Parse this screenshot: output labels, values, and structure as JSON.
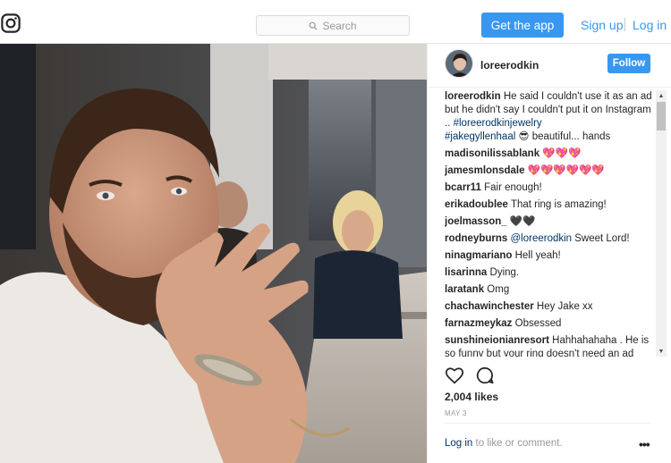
{
  "nav": {
    "search_placeholder": "Search",
    "get_app_label": "Get the app",
    "signup_label": "Sign up",
    "login_label": "Log in"
  },
  "post": {
    "owner": "loreerodkin",
    "follow_label": "Follow",
    "caption": {
      "user": "loreerodkin",
      "text_1": " He said I couldn't use it as an ad but he didn't say I couldn't put it on Instagram .. ",
      "tag_1": "#loreerodkinjewelry",
      "tag_2": "#jakegyllenhaal",
      "emoji": " 😎 ",
      "text_2": "beautiful... hands"
    },
    "comments": [
      {
        "user": "madisonilissablank",
        "text": " 💖💖💖"
      },
      {
        "user": "jamesmlonsdale",
        "text": " 💖💖💖💖💖💖"
      },
      {
        "user": "bcarr11",
        "text": " Fair enough!"
      },
      {
        "user": "erikadoublee",
        "text": " That ring is amazing!"
      },
      {
        "user": "joelmasson_",
        "text": " 🖤🖤"
      },
      {
        "user": "rodneyburns",
        "mention": " @loreerodkin",
        "text": " Sweet Lord!"
      },
      {
        "user": "ninagmariano",
        "text": " Hell yeah!"
      },
      {
        "user": "lisarinna",
        "text": " Dying."
      },
      {
        "user": "laratank",
        "text": " Omg"
      },
      {
        "user": "chachawinchester",
        "text": " Hey Jake xx"
      },
      {
        "user": "farnazmeykaz",
        "text": " Obsessed"
      },
      {
        "user": "sunshineionianresort",
        "text": " Hahhahahaha . He is so funny but your ring doesn't need an ad"
      }
    ],
    "likes": "2,004 likes",
    "date": "MAY 3",
    "login_link": "Log in",
    "login_suffix": " to like or comment.",
    "more_glyph": "•••"
  },
  "icons": {
    "logo": "instagram-logo-icon",
    "search": "search-icon",
    "like": "heart-icon",
    "comment": "comment-icon"
  },
  "colors": {
    "accent": "#3897f0",
    "link_dark": "#003569",
    "muted": "#999999"
  }
}
